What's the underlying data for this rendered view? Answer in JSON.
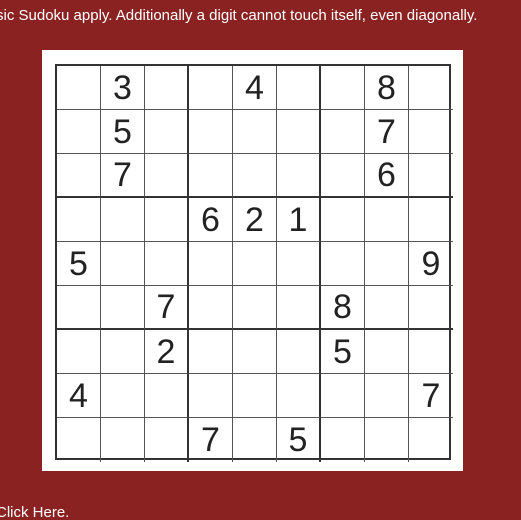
{
  "rules_text": "sic Sudoku apply. Additionally a digit cannot touch itself, even diagonally.",
  "link_text": "Click Here.",
  "colors": {
    "background": "#8b2222",
    "text": "#ffffff",
    "board": "#ffffff",
    "digit": "#222222"
  },
  "grid": [
    [
      "",
      "3",
      "",
      "",
      "4",
      "",
      "",
      "8",
      ""
    ],
    [
      "",
      "5",
      "",
      "",
      "",
      "",
      "",
      "7",
      ""
    ],
    [
      "",
      "7",
      "",
      "",
      "",
      "",
      "",
      "6",
      ""
    ],
    [
      "",
      "",
      "",
      "6",
      "2",
      "1",
      "",
      "",
      ""
    ],
    [
      "5",
      "",
      "",
      "",
      "",
      "",
      "",
      "",
      "9"
    ],
    [
      "",
      "",
      "7",
      "",
      "",
      "",
      "8",
      "",
      ""
    ],
    [
      "",
      "",
      "2",
      "",
      "",
      "",
      "5",
      "",
      ""
    ],
    [
      "4",
      "",
      "",
      "",
      "",
      "",
      "",
      "",
      "7"
    ],
    [
      "",
      "",
      "",
      "7",
      "",
      "5",
      "",
      "",
      ""
    ]
  ]
}
